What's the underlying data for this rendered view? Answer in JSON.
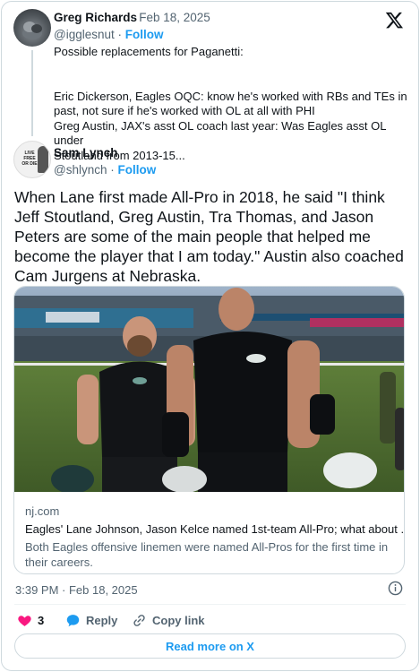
{
  "colors": {
    "accent": "#1d9bf0",
    "muted": "#536471",
    "like": "#f91880",
    "border": "#cfd9de"
  },
  "quoted_tweet": {
    "author_name": "Greg Richards",
    "separator": "·",
    "date": "Feb 18, 2025",
    "handle": "@igglesnut",
    "follow_label": "Follow",
    "lines": [
      "Possible replacements for Paganetti:",
      "",
      "Eric Dickerson, Eagles OQC: know he's worked with RBs and TEs in",
      "past, not sure if he's worked with OL at all with PHI",
      "Greg Austin, JAX's asst OL coach last year: Was Eagles asst OL under",
      "Stoutland from 2013-15..."
    ]
  },
  "main_tweet": {
    "author_name": "Sam Lynch",
    "handle": "@shlynch",
    "separator": "·",
    "follow_label": "Follow",
    "avatar_text": [
      "LIVE",
      "FREE",
      "OR DIE"
    ],
    "text": "When Lane first made All-Pro in 2018, he said \"I think Jeff Stoutland, Greg Austin, Tra Thomas, and Jason Peters are some of the main people that helped me become the player that I am today.\" Austin also coached Cam Jurgens at Nebraska.",
    "link_card": {
      "domain": "nj.com",
      "title": "Eagles' Lane Johnson, Jason Kelce named 1st-team All-Pro; what about ...",
      "description": "Both Eagles offensive linemen were named All-Pros for the first time in their careers."
    },
    "timestamp": "3:39 PM · Feb 18, 2025",
    "actions": {
      "like_count": "3",
      "reply_label": "Reply",
      "copy_link_label": "Copy link"
    },
    "read_more_label": "Read more on X"
  },
  "icons": [
    "x-logo-icon",
    "info-icon",
    "heart-icon",
    "reply-icon",
    "link-icon"
  ]
}
